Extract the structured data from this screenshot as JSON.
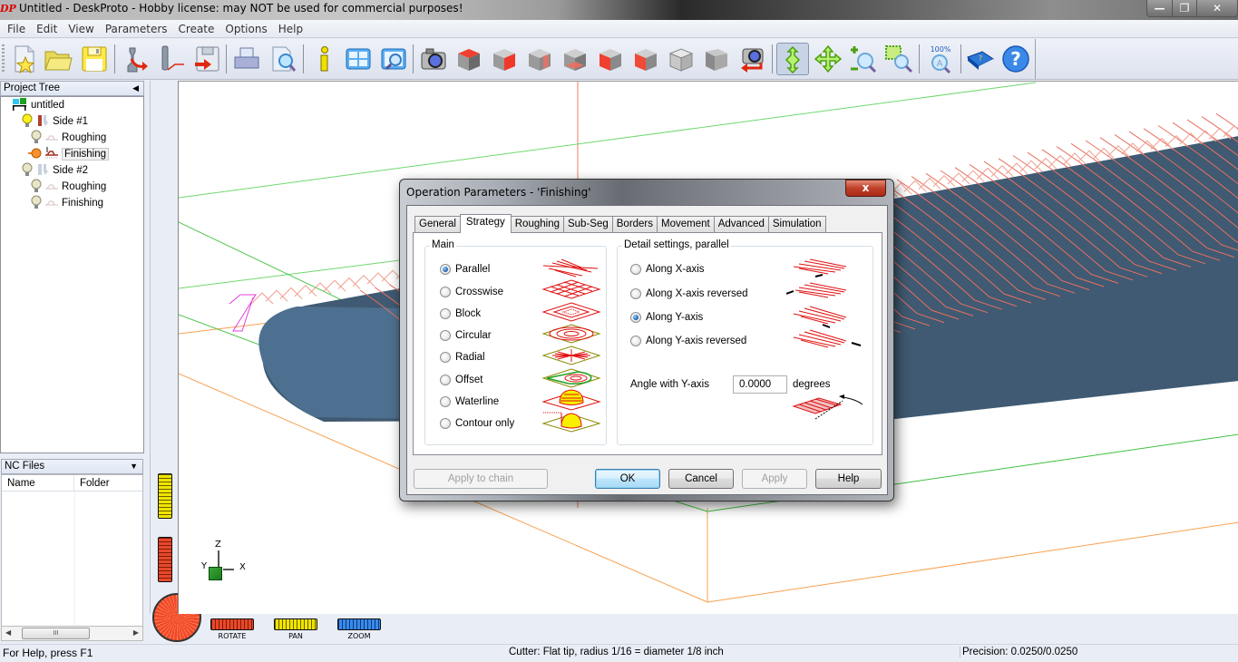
{
  "window": {
    "app_icon": "DP",
    "title": "Untitled - DeskProto - Hobby license: may NOT be used for commercial purposes!",
    "controls": {
      "minimize": "—",
      "restore": "❐",
      "close": "✕"
    }
  },
  "menu": [
    "File",
    "Edit",
    "View",
    "Parameters",
    "Create",
    "Options",
    "Help"
  ],
  "toolbar": {
    "buttons": [
      {
        "icon": "new-file-icon"
      },
      {
        "icon": "open-folder-icon"
      },
      {
        "icon": "save-icon"
      },
      {
        "icon": "import-geometry-icon"
      },
      {
        "icon": "import-toolpath-icon"
      },
      {
        "icon": "write-nc-icon"
      },
      {
        "icon": "print-icon"
      },
      {
        "icon": "print-preview-icon"
      },
      {
        "icon": "info-icon"
      },
      {
        "icon": "window-layout-icon"
      },
      {
        "icon": "view-zoom-window-icon"
      },
      {
        "icon": "camera-icon"
      },
      {
        "icon": "view-top-icon"
      },
      {
        "icon": "view-front-icon"
      },
      {
        "icon": "view-right-icon"
      },
      {
        "icon": "view-bottom-icon"
      },
      {
        "icon": "view-back-icon"
      },
      {
        "icon": "view-left-icon"
      },
      {
        "icon": "view-iso-icon"
      },
      {
        "icon": "view-iso2-icon"
      },
      {
        "icon": "camera-restore-icon"
      },
      {
        "icon": "rotate-mode-icon",
        "active": true
      },
      {
        "icon": "pan-mode-icon"
      },
      {
        "icon": "zoom-mode-icon"
      },
      {
        "icon": "zoom-window-icon"
      },
      {
        "icon": "zoom-100-icon",
        "label": "100%"
      },
      {
        "icon": "manual-book-icon"
      },
      {
        "icon": "help-icon"
      }
    ]
  },
  "project_tree": {
    "title": "Project Tree",
    "items": [
      {
        "label": "untitled",
        "level": 0,
        "icon": "project-icon"
      },
      {
        "label": "Side #1",
        "level": 1,
        "icon": "side-icon",
        "active": true
      },
      {
        "label": "Roughing",
        "level": 2,
        "icon": "operation-icon"
      },
      {
        "label": "Finishing",
        "level": 2,
        "icon": "operation-icon",
        "selected": true
      },
      {
        "label": "Side #2",
        "level": 1,
        "icon": "side-icon"
      },
      {
        "label": "Roughing",
        "level": 2,
        "icon": "operation-icon"
      },
      {
        "label": "Finishing",
        "level": 2,
        "icon": "operation-icon"
      }
    ]
  },
  "nc_files": {
    "title": "NC Files",
    "columns": [
      "Name",
      "Folder"
    ],
    "rows": []
  },
  "viewport": {
    "axes": {
      "x": "X",
      "y": "Y",
      "z": "Z"
    },
    "wheels": [
      {
        "label": "ROTATE",
        "color": "#d83a1e"
      },
      {
        "label": "PAN",
        "color": "#e6d800"
      },
      {
        "label": "ZOOM",
        "color": "#2f7fd8"
      }
    ]
  },
  "dialog": {
    "title": "Operation Parameters - 'Finishing'",
    "close": "x",
    "tabs": [
      "General",
      "Strategy",
      "Roughing",
      "Sub-Seg",
      "Borders",
      "Movement",
      "Advanced",
      "Simulation"
    ],
    "active_tab": "Strategy",
    "main_group": {
      "label": "Main",
      "options": [
        {
          "label": "Parallel",
          "checked": true,
          "pic": "parallel"
        },
        {
          "label": "Crosswise",
          "checked": false,
          "pic": "crosswise"
        },
        {
          "label": "Block",
          "checked": false,
          "pic": "block"
        },
        {
          "label": "Circular",
          "checked": false,
          "pic": "circular"
        },
        {
          "label": "Radial",
          "checked": false,
          "pic": "radial"
        },
        {
          "label": "Offset",
          "checked": false,
          "pic": "offset"
        },
        {
          "label": "Waterline",
          "checked": false,
          "pic": "waterline"
        },
        {
          "label": "Contour only",
          "checked": false,
          "pic": "contour"
        }
      ]
    },
    "detail_group": {
      "label": "Detail settings, parallel",
      "options": [
        {
          "label": "Along X-axis",
          "checked": false
        },
        {
          "label": "Along X-axis reversed",
          "checked": false
        },
        {
          "label": "Along Y-axis",
          "checked": true
        },
        {
          "label": "Along Y-axis reversed",
          "checked": false
        }
      ],
      "angle_label": "Angle with Y-axis",
      "angle_value": "0.0000",
      "angle_unit": "degrees"
    },
    "buttons": {
      "apply_chain": "Apply to chain",
      "ok": "OK",
      "cancel": "Cancel",
      "apply": "Apply",
      "help": "Help"
    }
  },
  "statusbar": {
    "help": "For Help, press F1",
    "cutter": "Cutter: Flat tip, radius 1/16 = diameter 1/8 inch",
    "precision": "Precision: 0.0250/0.0250"
  }
}
